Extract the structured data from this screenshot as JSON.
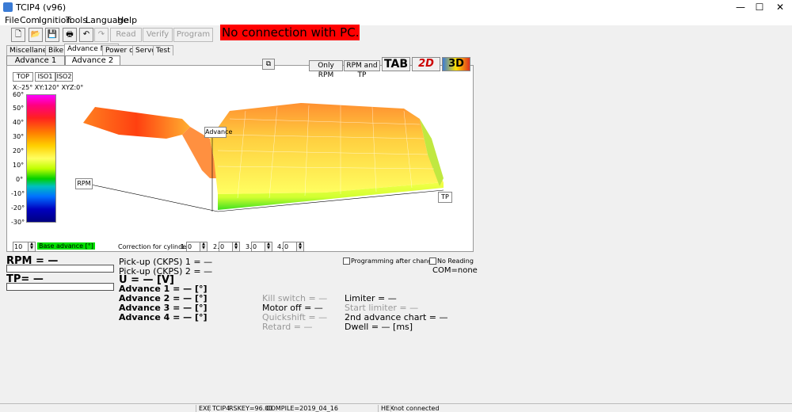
{
  "window": {
    "title": "TCIP4 (v96)",
    "min": "—",
    "max": "☐",
    "close": "✕"
  },
  "menu": [
    "File",
    "Com",
    "Ignition",
    "Tools",
    "Language",
    "Help"
  ],
  "toolbar": {
    "read": "Read",
    "verify": "Verify",
    "program": "Program"
  },
  "connection_banner": "No connection with PC...",
  "tabs": [
    "Miscellaneous",
    "Bike",
    "Advance Map",
    "Power out",
    "Servo",
    "Test"
  ],
  "subtabs": [
    "Advance 1",
    "Advance 2"
  ],
  "view": {
    "only_rpm": "Only RPM",
    "rpm_tp": "RPM and TP",
    "tab": "TAB",
    "two_d": "2D",
    "three_d": "3D"
  },
  "view_tabs": [
    "TOP",
    "ISO1",
    "ISO2"
  ],
  "rotation": "X:-25°  XY:120°  XYZ:0°",
  "scale_labels": [
    "60°",
    "50°",
    "40°",
    "30°",
    "20°",
    "10°",
    "0°",
    "-10°",
    "-20°",
    "-30°"
  ],
  "axis": {
    "advance": "Advance",
    "rpm": "RPM",
    "tp": "TP"
  },
  "spin_value": "10",
  "base_advance_label": "Base advance [°]",
  "correction_label": "Correction for cylinder:",
  "cylinders": [
    {
      "n": "1.",
      "v": "0"
    },
    {
      "n": "2.",
      "v": "0"
    },
    {
      "n": "3.",
      "v": "0"
    },
    {
      "n": "4.",
      "v": "0"
    }
  ],
  "readouts": {
    "rpm": "RPM = —",
    "tp": "TP= —",
    "pickup1": "Pick-up (CKPS) 1 = —",
    "pickup2": "Pick-up (CKPS) 2 = —",
    "u": "U = — [V]",
    "adv1": "Advance 1 = — [°]",
    "adv2": "Advance 2 = — [°]",
    "adv3": "Advance 3 = — [°]",
    "adv4": "Advance 4 = — [°]",
    "kill": "Kill switch = —",
    "motor_off": "Motor off = —",
    "quickshift": "Quickshift = —",
    "retard": "Retard = —",
    "limiter": "Limiter = —",
    "start_limiter": "Start limiter = —",
    "adv_chart2": "2nd advance chart = —",
    "dwell": "Dwell = — [ms]",
    "prog_after": "Programming after change",
    "no_reading": "No Reading",
    "com": "COM=none"
  },
  "status": {
    "exe": "EXE",
    "tcip": "TCIP4",
    "rskey": "RSKEY=96.00",
    "compile": "COMPILE=2019_04_16",
    "hex": "HEX",
    "conn": "not connected"
  }
}
